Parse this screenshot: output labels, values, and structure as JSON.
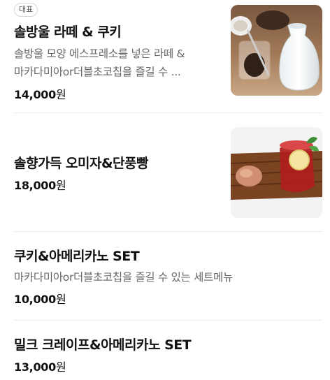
{
  "items": [
    {
      "badge": "대표",
      "name": "솔방울 라떼 & 쿠키",
      "description_lines": [
        "솔방울 모양 에스프레소를 넣은 라떼 &",
        "마카다미아or더블초코칩을 즐길 수 ..."
      ],
      "price": "14,000",
      "currency": "원"
    },
    {
      "name": "솔향가득 오미자&단풍빵",
      "price": "18,000",
      "currency": "원"
    },
    {
      "name": "쿠키&아메리카노 SET",
      "description_lines": [
        "마카다미아or더블초코칩을 즐길 수 있는 세트메뉴"
      ],
      "price": "10,000",
      "currency": "원"
    },
    {
      "name": "밀크 크레이프&아메리카노 SET",
      "price": "13,000",
      "currency": "원"
    }
  ]
}
